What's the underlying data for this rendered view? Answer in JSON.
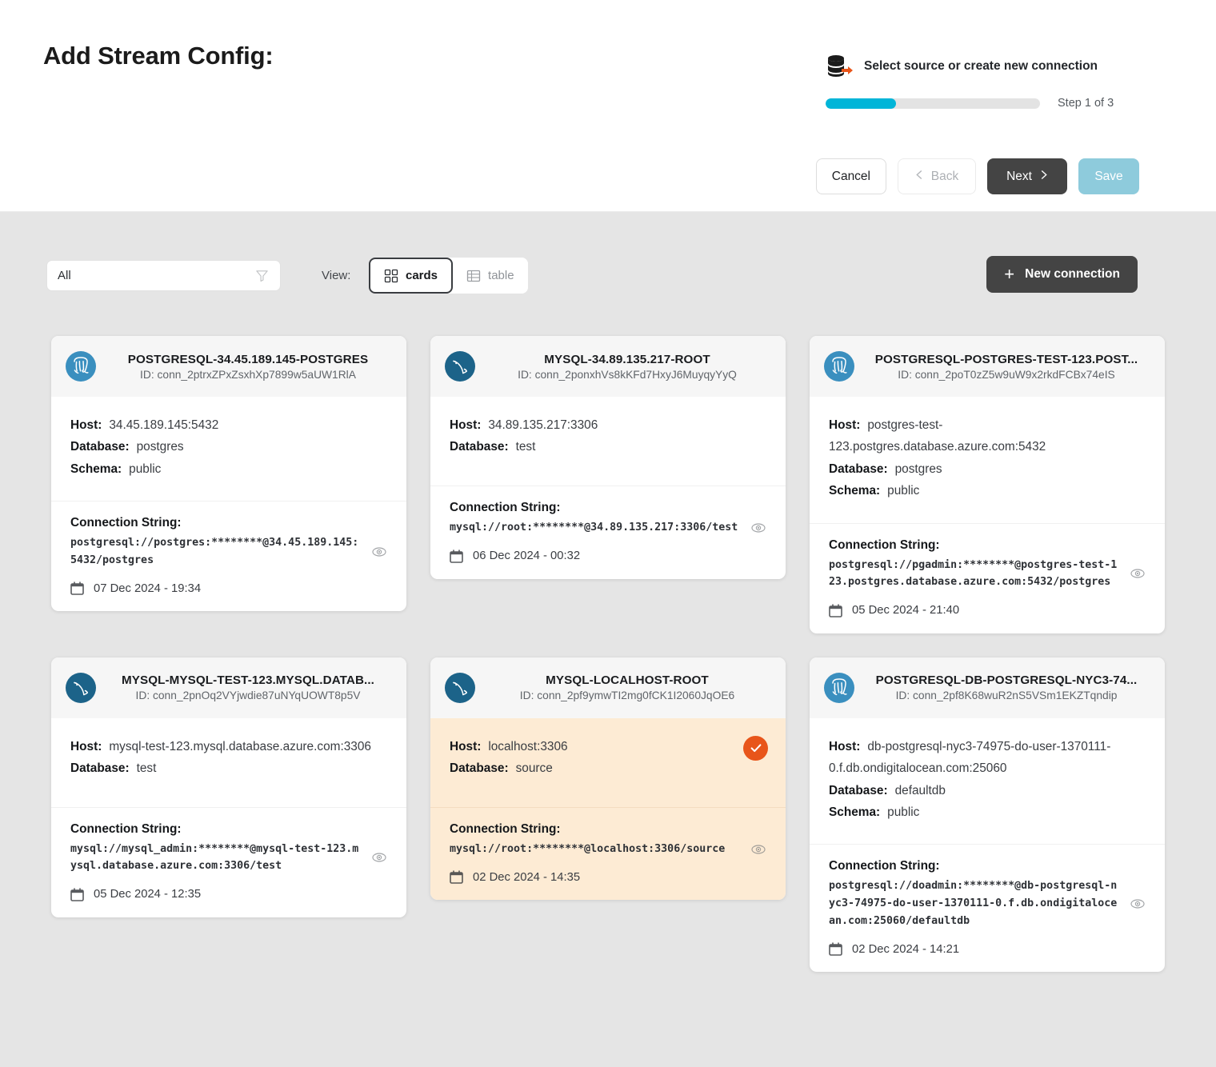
{
  "header": {
    "title": "Add Stream Config:",
    "wizard": {
      "icon": "database-export-icon",
      "step_label": "Select source or create new connection",
      "step_text": "Step 1 of 3",
      "progress_percent": 33,
      "progress_color": "#00b5d8",
      "track_color": "#e3e3e3"
    },
    "buttons": {
      "cancel": "Cancel",
      "back": "Back",
      "next": "Next",
      "save": "Save"
    }
  },
  "toolbar": {
    "filter_value": "All",
    "view_label": "View:",
    "view_options": [
      {
        "label": "cards",
        "icon": "grid-icon",
        "active": true
      },
      {
        "label": "table",
        "icon": "table-icon",
        "active": false
      }
    ],
    "new_connection_label": "New connection"
  },
  "labels": {
    "host": "Host:",
    "database": "Database:",
    "schema": "Schema:",
    "connection_string": "Connection String:",
    "id_prefix": "ID:"
  },
  "cards": [
    {
      "type": "postgresql",
      "title": "POSTGRESQL-34.45.189.145-POSTGRES",
      "id": "ID: conn_2ptrxZPxZsxhXp7899w5aUW1RlA",
      "host": "34.45.189.145:5432",
      "database": "postgres",
      "schema": "public",
      "connection_string": "postgresql://postgres:********@34.45.189.145:5432/postgres",
      "date": "07 Dec 2024 - 19:34",
      "selected": false
    },
    {
      "type": "mysql",
      "title": "MYSQL-34.89.135.217-ROOT",
      "id": "ID: conn_2ponxhVs8kKFd7HxyJ6MuyqyYyQ",
      "host": "34.89.135.217:3306",
      "database": "test",
      "schema": null,
      "connection_string": "mysql://root:********@34.89.135.217:3306/test",
      "date": "06 Dec 2024 - 00:32",
      "selected": false
    },
    {
      "type": "postgresql",
      "title": "POSTGRESQL-POSTGRES-TEST-123.POST...",
      "id": "ID: conn_2poT0zZ5w9uW9x2rkdFCBx74eIS",
      "host": "postgres-test-123.postgres.database.azure.com:5432",
      "database": "postgres",
      "schema": "public",
      "connection_string": "postgresql://pgadmin:********@postgres-test-123.postgres.database.azure.com:5432/postgres",
      "date": "05 Dec 2024 - 21:40",
      "selected": false
    },
    {
      "type": "mysql",
      "title": "MYSQL-MYSQL-TEST-123.MYSQL.DATAB...",
      "id": "ID: conn_2pnOq2VYjwdie87uNYqUOWT8p5V",
      "host": "mysql-test-123.mysql.database.azure.com:3306",
      "database": "test",
      "schema": null,
      "connection_string": "mysql://mysql_admin:********@mysql-test-123.mysql.database.azure.com:3306/test",
      "date": "05 Dec 2024 - 12:35",
      "selected": false
    },
    {
      "type": "mysql",
      "title": "MYSQL-LOCALHOST-ROOT",
      "id": "ID: conn_2pf9ymwTI2mg0fCK1I2060JqOE6",
      "host": "localhost:3306",
      "database": "source",
      "schema": null,
      "connection_string": "mysql://root:********@localhost:3306/source",
      "date": "02 Dec 2024 - 14:35",
      "selected": true
    },
    {
      "type": "postgresql",
      "title": "POSTGRESQL-DB-POSTGRESQL-NYC3-74...",
      "id": "ID: conn_2pf8K68wuR2nS5VSm1EKZTqndip",
      "host": "db-postgresql-nyc3-74975-do-user-1370111-0.f.db.ondigitalocean.com:25060",
      "database": "defaultdb",
      "schema": "public",
      "connection_string": "postgresql://doadmin:********@db-postgresql-nyc3-74975-do-user-1370111-0.f.db.ondigitalocean.com:25060/defaultdb",
      "date": "02 Dec 2024 - 14:21",
      "selected": false
    }
  ],
  "colors": {
    "accent_orange": "#e8551a",
    "progress_cyan": "#00b5d8",
    "dark_button": "#444444",
    "save_disabled": "#8ecbdc",
    "page_background": "#e5e5e5",
    "postgres_logo": "#3a8fbf",
    "mysql_logo": "#1c6389",
    "selected_card_bg": "#fdebd4"
  }
}
